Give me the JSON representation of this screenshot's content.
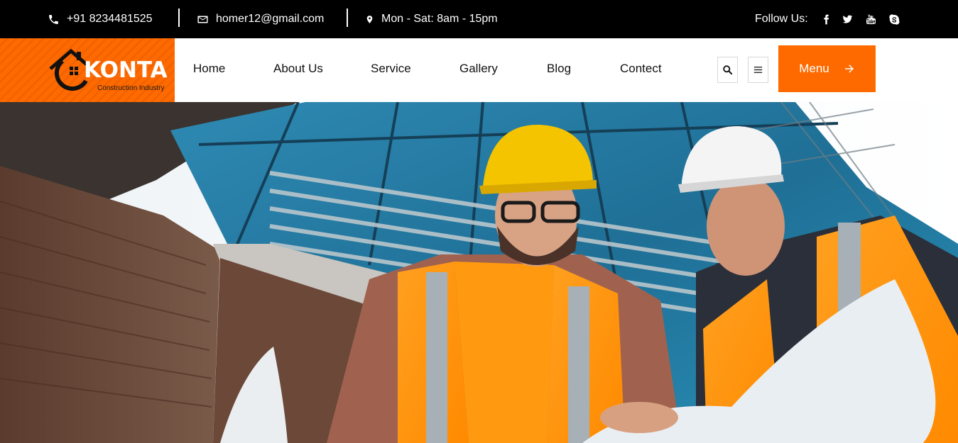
{
  "topbar": {
    "phone": "+91 8234481525",
    "email": "homer12@gmail.com",
    "hours": "Mon - Sat: 8am - 15pm",
    "follow_label": "Follow Us:",
    "socials": [
      "facebook-icon",
      "twitter-icon",
      "youtube-icon",
      "skype-icon"
    ]
  },
  "brand": {
    "name": "KONTA",
    "tagline": "Construction Industry",
    "accent": "#ff6a00"
  },
  "nav": {
    "items": [
      {
        "label": "Home"
      },
      {
        "label": "About Us"
      },
      {
        "label": "Service"
      },
      {
        "label": "Gallery"
      },
      {
        "label": "Blog"
      },
      {
        "label": "Contect"
      }
    ],
    "menu_button": "Menu"
  },
  "hero": {
    "image": "construction-workers-with-blueprints"
  }
}
